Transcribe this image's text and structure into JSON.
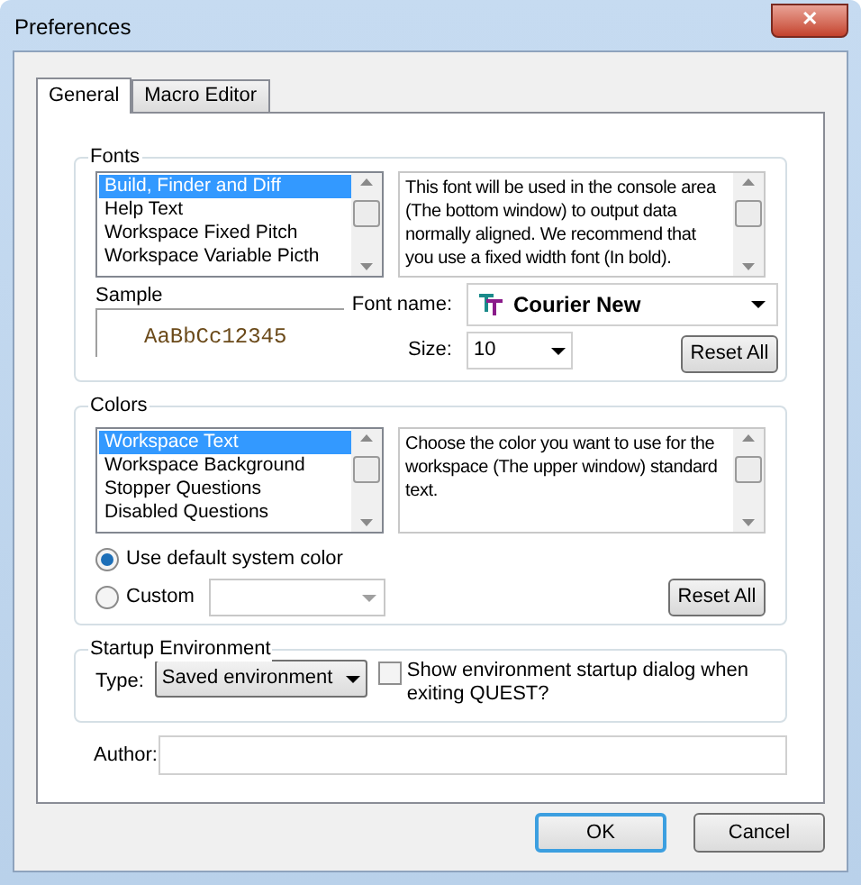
{
  "window": {
    "title": "Preferences",
    "close": "✕"
  },
  "tabs": [
    {
      "label": "General",
      "selected": true
    },
    {
      "label": "Macro Editor",
      "selected": false
    }
  ],
  "fonts": {
    "title": "Fonts",
    "items": [
      {
        "label": "Build, Finder and Diff",
        "selected": true
      },
      {
        "label": "Help Text",
        "selected": false
      },
      {
        "label": "Workspace Fixed Pitch",
        "selected": false
      },
      {
        "label": "Workspace Variable Picth",
        "selected": false
      }
    ],
    "description": "This font will  be used in the console area (The bottom window) to output data normally aligned. We recommend that you use a fixed width font (In bold).",
    "sample_label": "Sample",
    "sample": "AaBbCc12345",
    "font_name_label": "Font name:",
    "font_name": "Courier New",
    "size_label": "Size:",
    "size": "10",
    "reset": "Reset All"
  },
  "colors": {
    "title": "Colors",
    "items": [
      {
        "label": "Workspace Text",
        "selected": true
      },
      {
        "label": "Workspace Background",
        "selected": false
      },
      {
        "label": "Stopper Questions",
        "selected": false
      },
      {
        "label": "Disabled Questions",
        "selected": false
      }
    ],
    "description": "Choose the color you want to use for the workspace (The upper window) standard text.",
    "options": [
      {
        "label": "Use default system color",
        "selected": true
      },
      {
        "label": "Custom",
        "selected": false
      }
    ],
    "reset": "Reset All"
  },
  "startup": {
    "title": "Startup Environment",
    "type_label": "Type:",
    "type": "Saved environment",
    "show_dialog": {
      "label": "Show environment startup dialog when exiting QUEST?",
      "checked": false
    }
  },
  "author": {
    "label": "Author:"
  },
  "buttons": [
    {
      "label": "OK",
      "default": true
    },
    {
      "label": "Cancel",
      "default": false
    }
  ]
}
